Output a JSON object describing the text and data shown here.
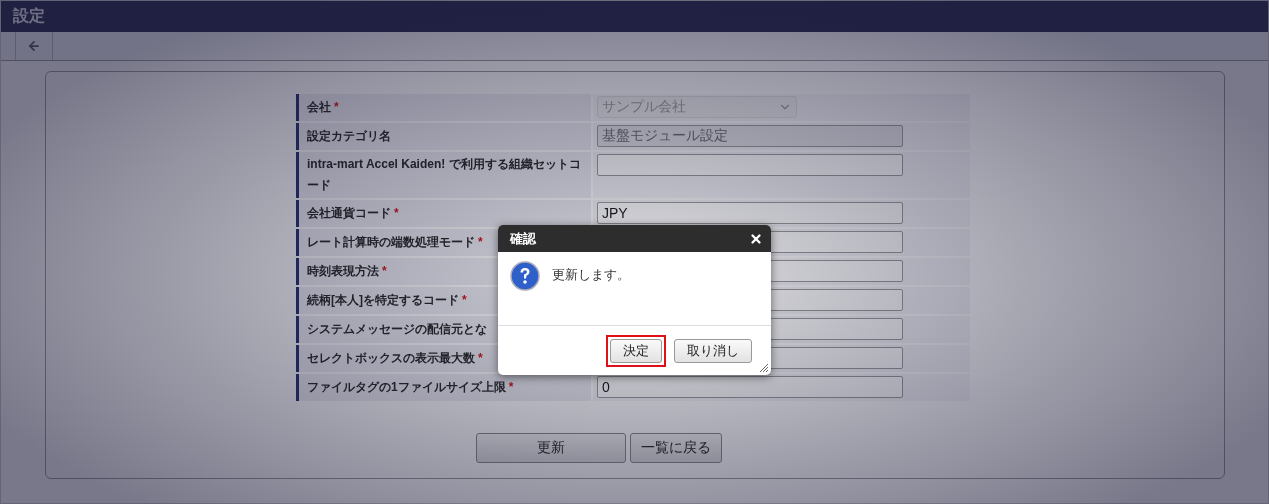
{
  "window": {
    "title": "設定"
  },
  "form": {
    "rows": [
      {
        "label": "会社",
        "required_mark": "*",
        "kind": "select",
        "value": "サンプル会社",
        "disabled": true
      },
      {
        "label": "設定カテゴリ名",
        "kind": "text",
        "value": "基盤モジュール設定",
        "disabled": true
      },
      {
        "label": "intra-mart Accel Kaiden! で利用する組織セットコード",
        "kind": "text",
        "disabled": false
      },
      {
        "label": "会社通貨コード",
        "required_mark": "*",
        "kind": "text",
        "value": "JPY",
        "disabled": false
      },
      {
        "label": "レート計算時の端数処理モード",
        "required_mark": "*",
        "kind": "text",
        "disabled": false
      },
      {
        "label": "時刻表現方法",
        "required_mark": "*",
        "kind": "text",
        "disabled": false
      },
      {
        "label": "続柄[本人]を特定するコード",
        "required_mark": "*",
        "kind": "text",
        "disabled": false
      },
      {
        "label": "システムメッセージの配信元とな",
        "kind": "text",
        "disabled": false
      },
      {
        "label": "セレクトボックスの表示最大数",
        "required_mark": "*",
        "kind": "text",
        "disabled": false
      },
      {
        "label": "ファイルタグの1ファイルサイズ上限",
        "required_mark": "*",
        "kind": "text",
        "value": "0",
        "disabled": false
      }
    ],
    "buttons": [
      {
        "label": "更新",
        "kind": "primary"
      },
      {
        "label": "一覧に戻る",
        "kind": "secondary"
      }
    ]
  },
  "dialog": {
    "title": "確認",
    "message": "更新します。",
    "buttons": [
      {
        "label": "決定",
        "highlighted": true
      },
      {
        "label": "取り消し",
        "highlighted": false
      }
    ]
  }
}
